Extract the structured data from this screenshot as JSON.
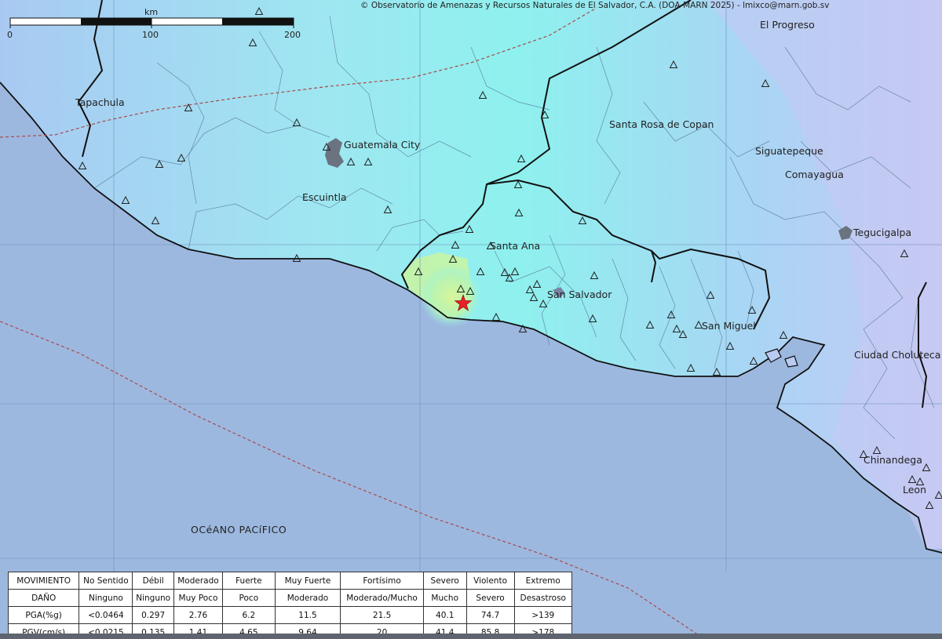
{
  "attribution": "© Observatorio de Amenazas y Recursos Naturales de El Salvador, C.A. (DOA-MARN 2025) - lmixco@marn.gob.sv",
  "scale_bar": {
    "unit": "km",
    "ticks": [
      "0",
      "100",
      "200"
    ]
  },
  "cities": {
    "el_progreso": "El Progreso",
    "tapachula": "Tapachula",
    "guatemala_city": "Guatemala City",
    "santa_rosa": "Santa Rosa de Copan",
    "siguatepeque": "Siguatepeque",
    "comayagua": "Comayagua",
    "escuintla": "Escuintla",
    "tegucigalpa": "Tegucigalpa",
    "santa_ana": "Santa Ana",
    "san_salvador": "San Salvador",
    "san_miguel": "San Miguel",
    "ciudad_choluteca": "Ciudad Choluteca",
    "chinandega": "Chinandega",
    "leon": "Leon"
  },
  "ocean_label": "OCéANO PACíFICO",
  "epicenter_icon": "red-star-icon",
  "station_icon": "triangle-station-icon",
  "colors": {
    "ocean": "#9db8df",
    "land": "#b9cbf2",
    "intensity_cyan": "#8ff1ee",
    "intensity_green": "#c9f5a0",
    "epicenter": "#e8202a",
    "lake": "#6b7380"
  },
  "legend": {
    "rows": [
      {
        "head": "MOVIMIENTO",
        "cells": [
          "No Sentido",
          "Débil",
          "Moderado",
          "Fuerte",
          "Muy Fuerte",
          "Fortísimo",
          "Severo",
          "Violento",
          "Extremo"
        ]
      },
      {
        "head": "DAÑO",
        "cells": [
          "Ninguno",
          "Ninguno",
          "Muy Poco",
          "Poco",
          "Moderado",
          "Moderado/Mucho",
          "Mucho",
          "Severo",
          "Desastroso"
        ]
      },
      {
        "head": "PGA(%g)",
        "cells": [
          "<0.0464",
          "0.297",
          "2.76",
          "6.2",
          "11.5",
          "21.5",
          "40.1",
          "74.7",
          ">139"
        ]
      },
      {
        "head": "PGV(cm/s)",
        "cells": [
          "<0.0215",
          "0.135",
          "1.41",
          "4.65",
          "9.64",
          "20",
          "41.4",
          "85.8",
          ">178"
        ]
      }
    ]
  }
}
